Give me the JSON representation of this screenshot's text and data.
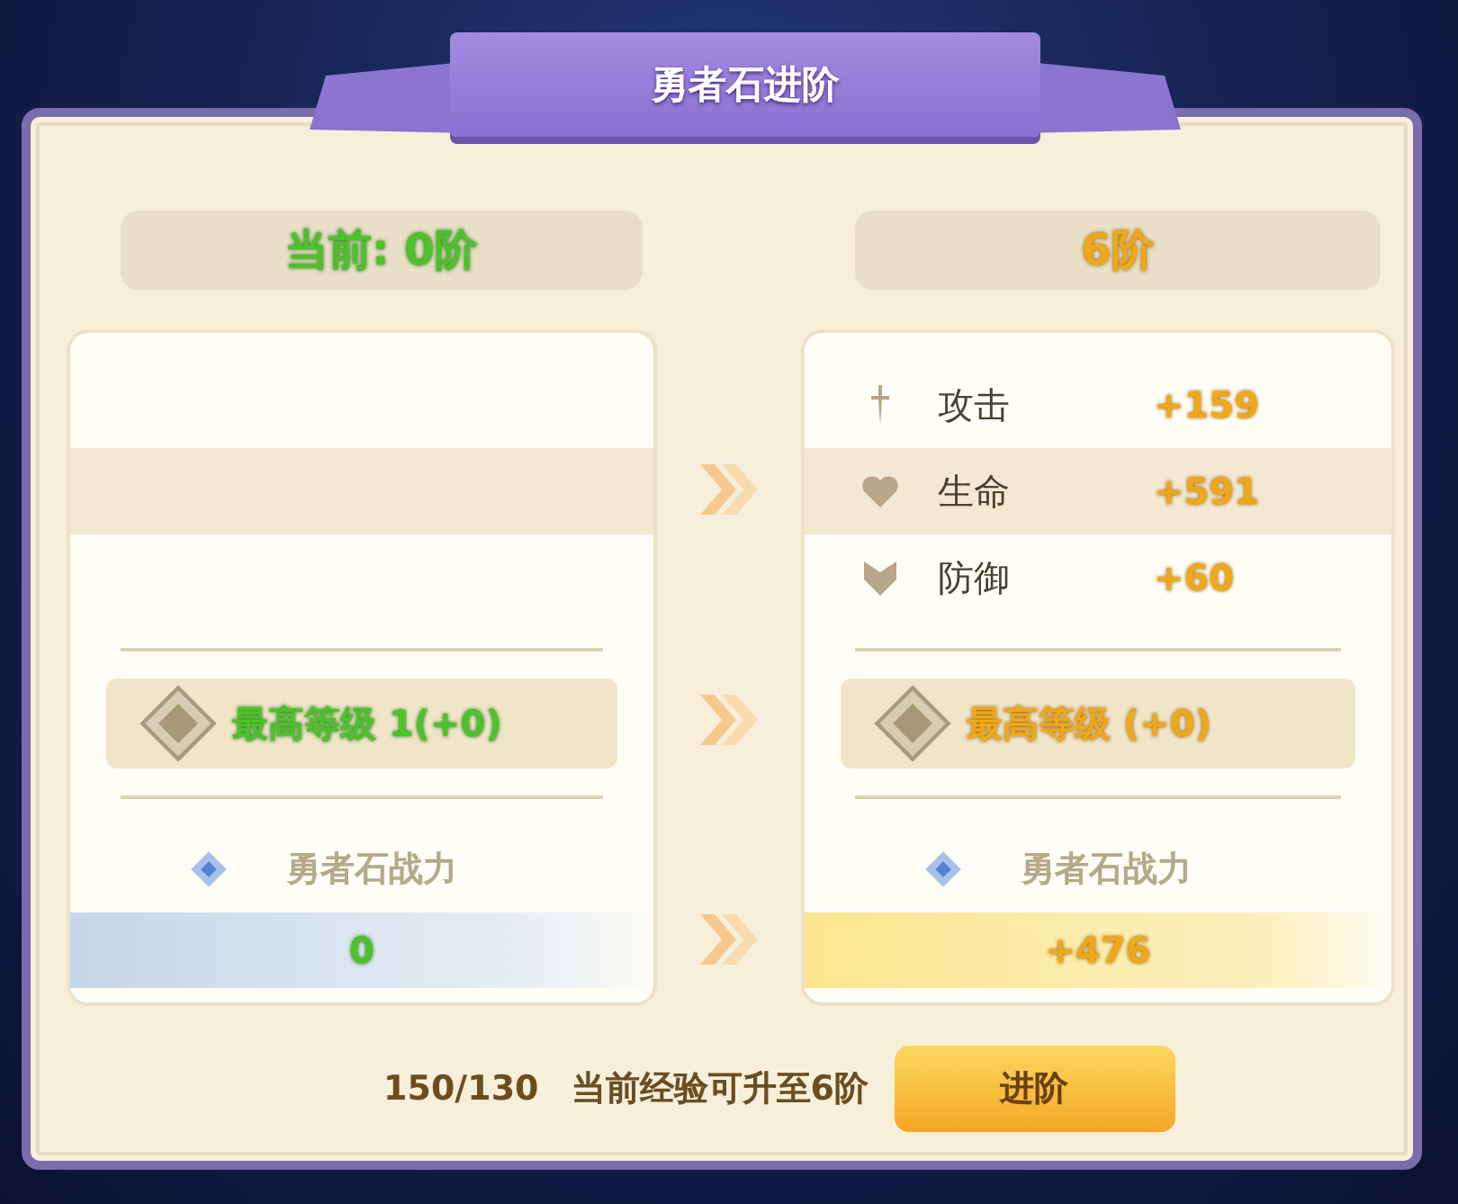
{
  "title": "勇者石进阶",
  "columns": [
    {
      "kind": "current",
      "header": "当前: 0阶",
      "max_level": "最高等级 1(+0)",
      "power_label": "勇者石战力",
      "power_value": "0"
    },
    {
      "kind": "next",
      "header": "6阶",
      "stats": [
        {
          "kind": "attack",
          "name": "攻击",
          "value": "+159"
        },
        {
          "kind": "health",
          "name": "生命",
          "value": "+591"
        },
        {
          "kind": "defense",
          "name": "防御",
          "value": "+60"
        }
      ],
      "max_level": "最高等级 (+0)",
      "power_label": "勇者石战力",
      "power_value": "+476"
    }
  ],
  "footer": {
    "exp": "150/130",
    "message": "当前经验可升至6阶",
    "button": "进阶"
  }
}
